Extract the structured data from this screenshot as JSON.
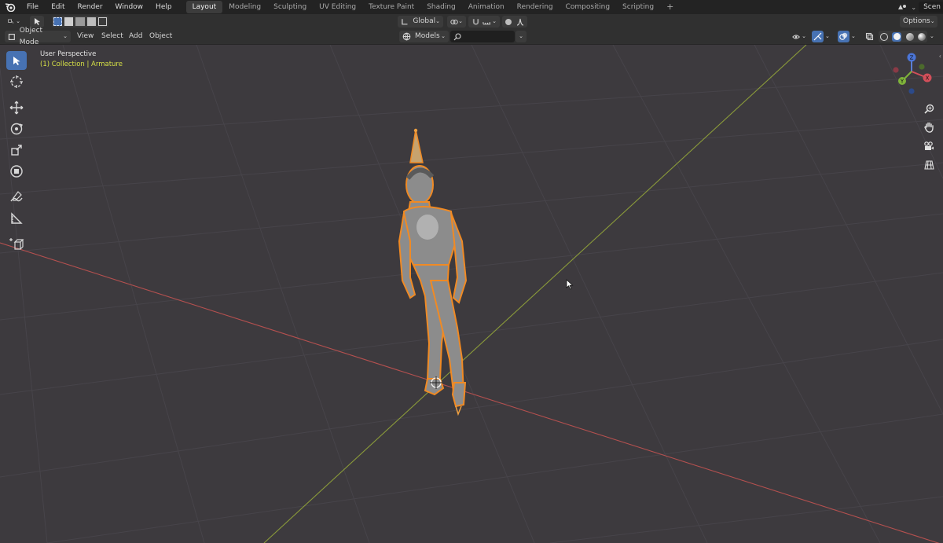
{
  "topbar": {
    "menus": [
      "File",
      "Edit",
      "Render",
      "Window",
      "Help"
    ],
    "workspaces": [
      "Layout",
      "Modeling",
      "Sculpting",
      "UV Editing",
      "Texture Paint",
      "Shading",
      "Animation",
      "Rendering",
      "Compositing",
      "Scripting"
    ],
    "active_workspace": "Layout",
    "add_tab": "+",
    "scene": "Scen"
  },
  "header": {
    "transform_orientation": "Global",
    "options_label": "Options",
    "mode": "Object Mode",
    "menus": [
      "View",
      "Select",
      "Add",
      "Object"
    ],
    "collection_filter": "Models",
    "search_placeholder": ""
  },
  "viewport": {
    "perspective_label": "User Perspective",
    "collection_label": "(1) Collection | Armature"
  },
  "navigation_gizmo": {
    "z_label": "Z",
    "x_label": "X",
    "y_label": "Y"
  },
  "colors": {
    "accent": "#4772b3",
    "selection_outline": "#f08a24",
    "x_axis": "#b4504f",
    "y_axis": "#8a9a3a",
    "viewport_bg": "#3d3a3e",
    "info_text": "#d6e046"
  },
  "icons": {
    "toolbar": [
      "select-box-icon",
      "cursor-icon",
      "move-icon",
      "rotate-icon",
      "scale-icon",
      "transform-icon",
      "annotate-icon",
      "measure-icon",
      "add-cube-icon"
    ],
    "navigation": [
      "zoom-icon",
      "hand-pan-icon",
      "camera-icon",
      "grid-toggle-icon"
    ]
  }
}
